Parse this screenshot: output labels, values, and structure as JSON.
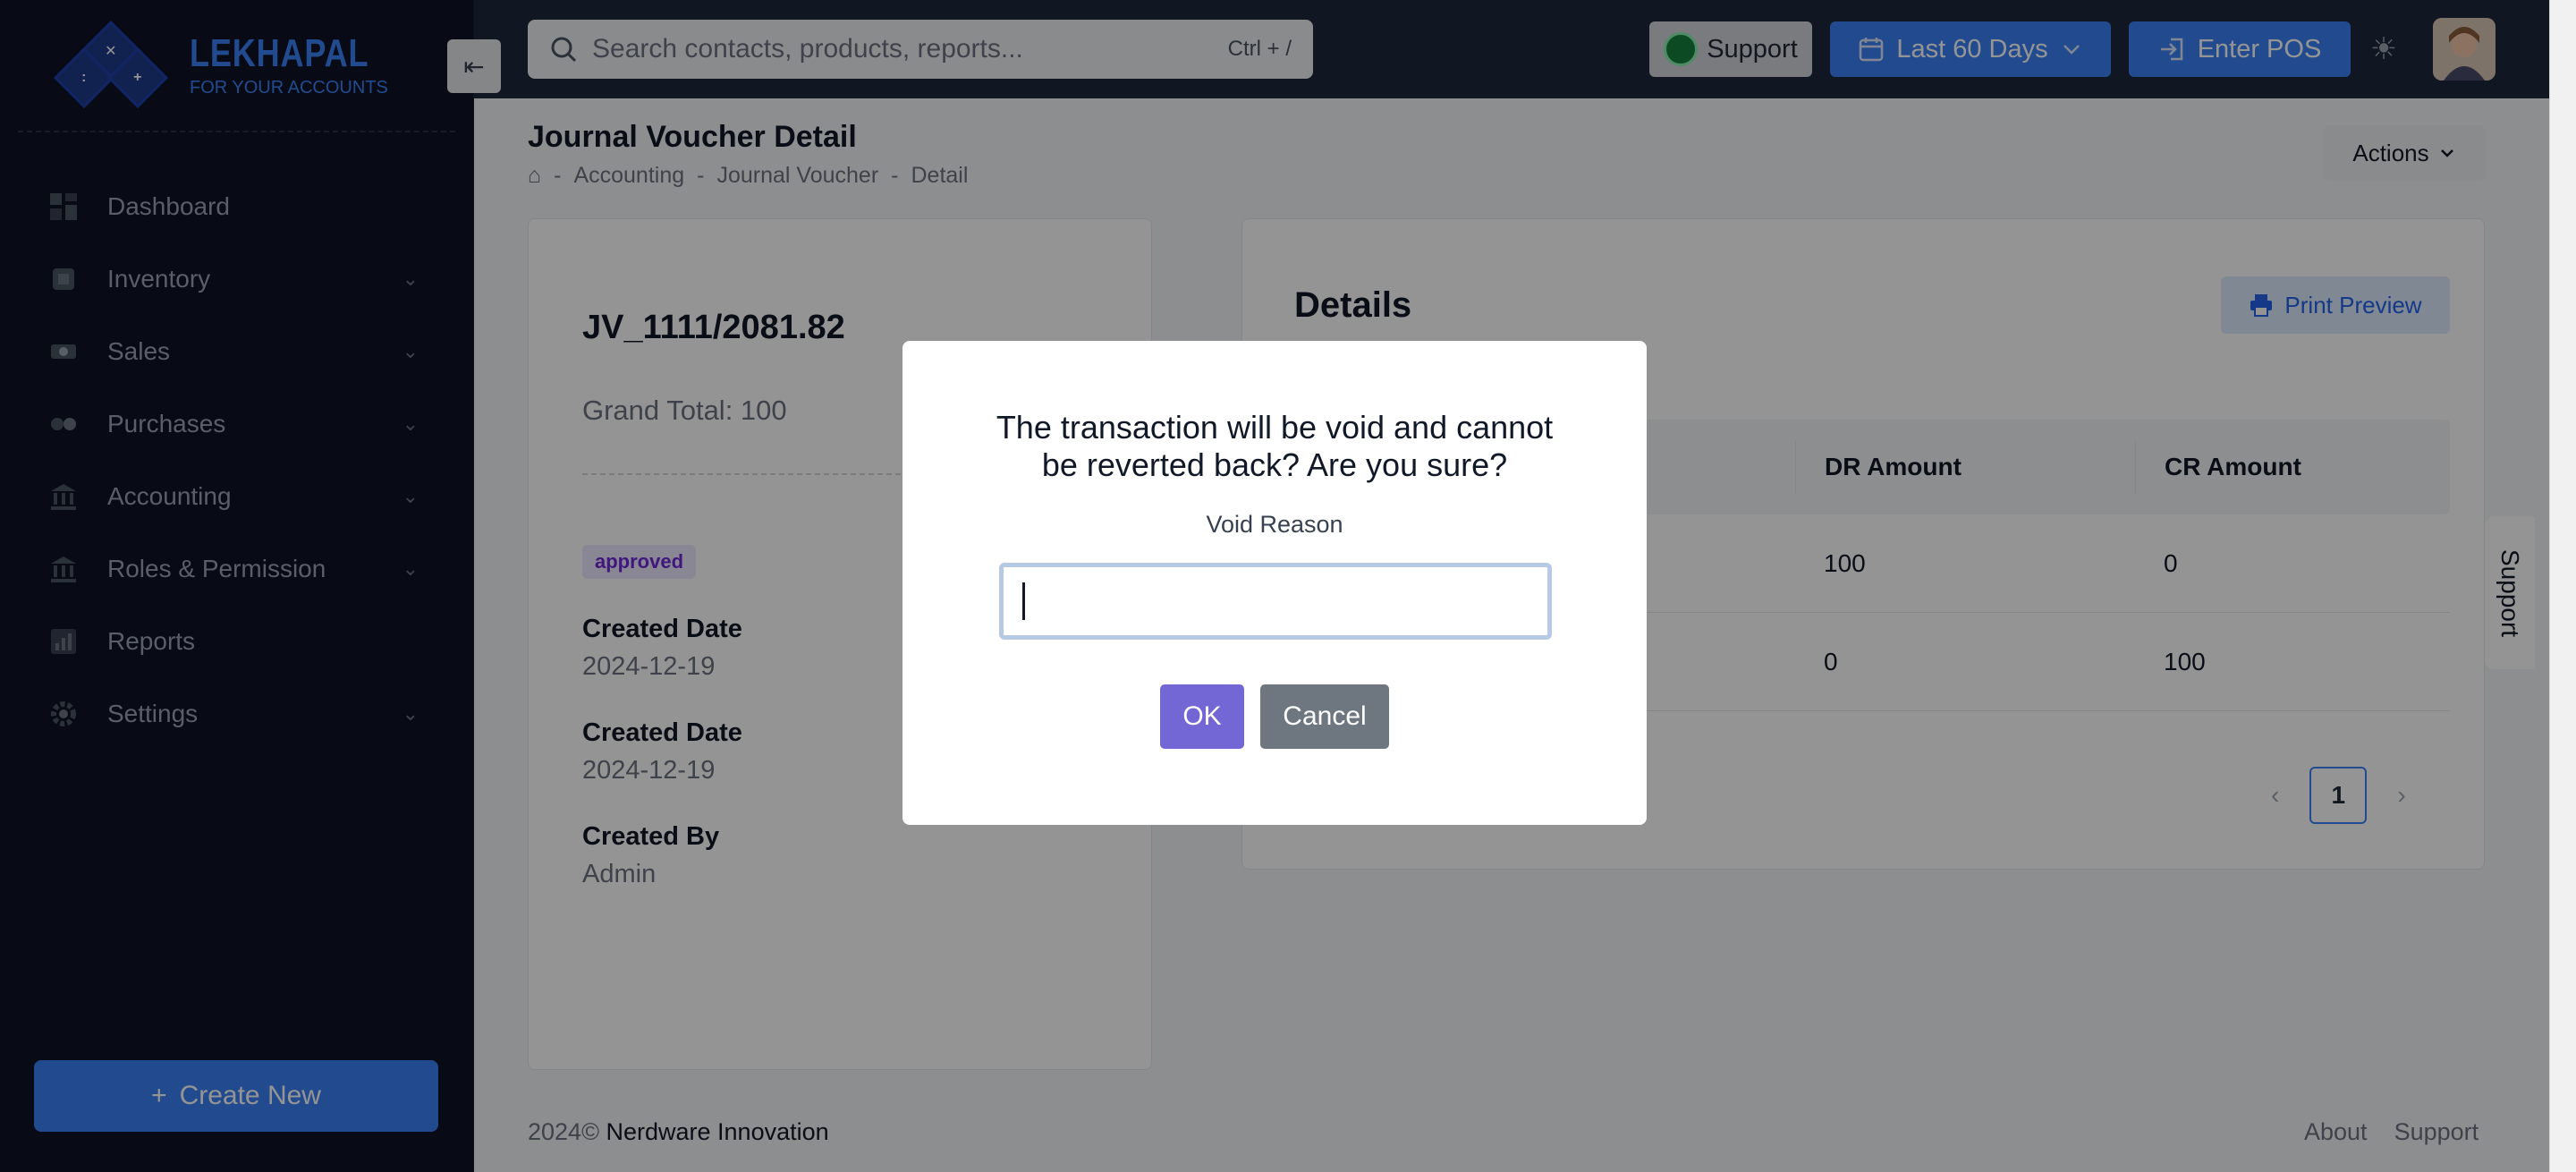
{
  "brand": {
    "title": "LEKHAPAL",
    "subtitle": "FOR YOUR ACCOUNTS"
  },
  "sidebar": {
    "items": [
      {
        "label": "Dashboard",
        "icon": "dashboard-icon",
        "expandable": false
      },
      {
        "label": "Inventory",
        "icon": "inventory-icon",
        "expandable": true
      },
      {
        "label": "Sales",
        "icon": "sales-icon",
        "expandable": true
      },
      {
        "label": "Purchases",
        "icon": "purchases-icon",
        "expandable": true
      },
      {
        "label": "Accounting",
        "icon": "bank-icon",
        "expandable": true
      },
      {
        "label": "Roles & Permission",
        "icon": "roles-icon",
        "expandable": true
      },
      {
        "label": "Reports",
        "icon": "reports-icon",
        "expandable": false
      },
      {
        "label": "Settings",
        "icon": "gear-icon",
        "expandable": true
      }
    ],
    "create_label": "Create New"
  },
  "topbar": {
    "search_placeholder": "Search contacts, products, reports...",
    "search_shortcut": "Ctrl + /",
    "support_label": "Support",
    "date_range_label": "Last 60 Days",
    "pos_label": "Enter POS"
  },
  "page": {
    "title": "Journal Voucher Detail",
    "breadcrumb": [
      "Accounting",
      "Journal Voucher",
      "Detail"
    ],
    "actions_label": "Actions"
  },
  "voucher": {
    "number": "JV_1111/2081.82",
    "grand_total": "Grand Total: 100",
    "status": "approved",
    "meta": [
      {
        "label": "Created Date",
        "value": "2024-12-19"
      },
      {
        "label": "Created Date",
        "value": "2024-12-19"
      },
      {
        "label": "Created By",
        "value": "Admin"
      }
    ]
  },
  "details": {
    "title": "Details",
    "print_label": "Print Preview",
    "columns": [
      "DR Amount",
      "CR Amount"
    ],
    "rows": [
      {
        "dr": "100",
        "cr": "0"
      },
      {
        "dr": "0",
        "cr": "100"
      }
    ],
    "current_page": "1"
  },
  "side_tab": {
    "label": "Support"
  },
  "footer": {
    "year": "2024©",
    "company": "Nerdware Innovation",
    "links": [
      "About",
      "Support"
    ]
  },
  "modal": {
    "message": "The transaction will be void and cannot be reverted back? Are you sure?",
    "label": "Void Reason",
    "input_value": "",
    "ok_label": "OK",
    "cancel_label": "Cancel"
  },
  "colors": {
    "sidebar_bg": "#0e1426",
    "topbar_bg": "#1e293b",
    "accent": "#3b82f6",
    "ok_button": "#7367d6",
    "cancel_button": "#6e7780"
  }
}
